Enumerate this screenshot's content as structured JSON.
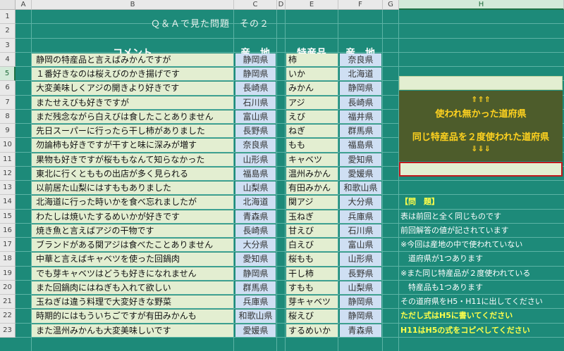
{
  "columns": [
    "A",
    "B",
    "C",
    "D",
    "E",
    "F",
    "G",
    "H"
  ],
  "rows": [
    1,
    2,
    3,
    4,
    5,
    6,
    7,
    8,
    9,
    10,
    11,
    12,
    13,
    14,
    15,
    16,
    17,
    18,
    19,
    20,
    21,
    22,
    23
  ],
  "title": "Ｑ＆Ａで見た問題　その２",
  "headers": {
    "comment": "コメント",
    "origin": "産　地",
    "product": "特産品",
    "origin2": "産　地"
  },
  "table": [
    {
      "comment": "静岡の特産品と言えばみかんですが",
      "origin": "静岡県",
      "product": "柿",
      "origin2": "奈良県"
    },
    {
      "comment": "１番好きなのは桜えびのかき揚げです",
      "origin": "静岡県",
      "product": "いか",
      "origin2": "北海道"
    },
    {
      "comment": "大変美味しくアジの開きより好きです",
      "origin": "長崎県",
      "product": "みかん",
      "origin2": "静岡県"
    },
    {
      "comment": "またせえびも好きですが",
      "origin": "石川県",
      "product": "アジ",
      "origin2": "長崎県"
    },
    {
      "comment": "まだ残念ながら白えびは食したことありません",
      "origin": "富山県",
      "product": "えび",
      "origin2": "福井県"
    },
    {
      "comment": "先日スーパーに行ったら干し柿がありました",
      "origin": "長野県",
      "product": "ねぎ",
      "origin2": "群馬県"
    },
    {
      "comment": "勿論柿も好きですが干すと味に深みが増す",
      "origin": "奈良県",
      "product": "もも",
      "origin2": "福島県"
    },
    {
      "comment": "果物も好きですが桜ももなんて知らなかった",
      "origin": "山形県",
      "product": "キャベツ",
      "origin2": "愛知県"
    },
    {
      "comment": "東北に行くとももの出店が多く見られる",
      "origin": "福島県",
      "product": "温州みかん",
      "origin2": "愛媛県"
    },
    {
      "comment": "以前居た山梨にはすももありました",
      "origin": "山梨県",
      "product": "有田みかん",
      "origin2": "和歌山県"
    },
    {
      "comment": "北海道に行った時いかを食べ忘れましたが",
      "origin": "北海道",
      "product": "関アジ",
      "origin2": "大分県"
    },
    {
      "comment": "わたしは焼いたするめいかが好きです",
      "origin": "青森県",
      "product": "玉ねぎ",
      "origin2": "兵庫県"
    },
    {
      "comment": "焼き魚と言えばアジの干物です",
      "origin": "長崎県",
      "product": "甘えび",
      "origin2": "石川県"
    },
    {
      "comment": "ブランドがある関アジは食べたことありません",
      "origin": "大分県",
      "product": "白えび",
      "origin2": "富山県"
    },
    {
      "comment": "中華と言えばキャベツを使った回鍋肉",
      "origin": "愛知県",
      "product": "桜もも",
      "origin2": "山形県"
    },
    {
      "comment": "でも芽キャベツはどうも好きになれません",
      "origin": "静岡県",
      "product": "干し柿",
      "origin2": "長野県"
    },
    {
      "comment": "また回鍋肉にはねぎも入れて欲しい",
      "origin": "群馬県",
      "product": "すもも",
      "origin2": "山梨県"
    },
    {
      "comment": "玉ねぎは違う料理で大変好きな野菜",
      "origin": "兵庫県",
      "product": "芽キャベツ",
      "origin2": "静岡県"
    },
    {
      "comment": "時期的にはもういちごですが有田みかんも",
      "origin": "和歌山県",
      "product": "桜えび",
      "origin2": "静岡県"
    },
    {
      "comment": "また温州みかんも大変美味しいです",
      "origin": "愛媛県",
      "product": "するめいか",
      "origin2": "青森県"
    }
  ],
  "box": {
    "arrow_up": "⇑⇑⇑",
    "line1": "使われ無かった道府県",
    "line2": "同じ特産品を２度使われた道府県",
    "arrow_down": "⇓⇓⇓"
  },
  "question": [
    "【問　題】",
    "表は前回と全く同じものです",
    "前回解答の値が記されています",
    "※今回は産地の中で使われていない",
    "　道府県が1つあります",
    "※また同じ特産品が２度使われている",
    "　特産品も1つあります",
    "その道府県をH5・H11に出してください",
    "ただし式はH5に書いてください",
    "H11はH5の式をコピペしてください"
  ],
  "colors": {
    "background": "#1d8a79",
    "accent_box": "#4d5c2b",
    "highlight_text": "#ffff4a",
    "answer_border": "#c0191d"
  }
}
